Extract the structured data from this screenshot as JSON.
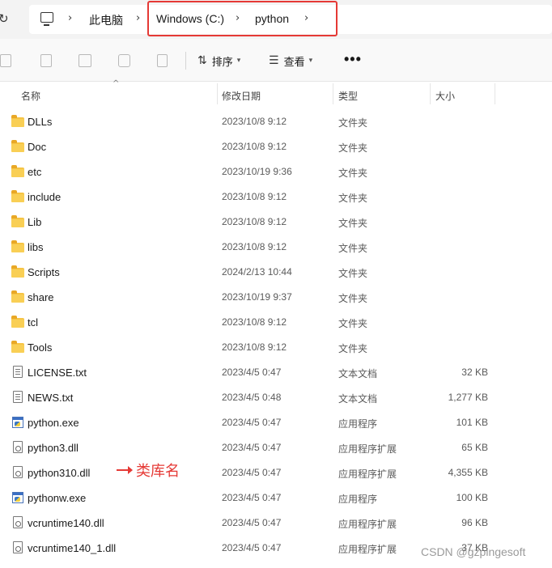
{
  "address": {
    "crumbs": [
      "此电脑",
      "Windows (C:)",
      "python"
    ],
    "highlight_color": "#e53935"
  },
  "toolbar": {
    "sort_label": "排序",
    "view_label": "查看",
    "more_label": "•••",
    "icons": [
      "copy-icon",
      "paste-icon",
      "rename-icon",
      "share-icon",
      "delete-icon"
    ]
  },
  "columns": {
    "name": "名称",
    "date": "修改日期",
    "type": "类型",
    "size": "大小"
  },
  "files": [
    {
      "name": "DLLs",
      "date": "2023/10/8 9:12",
      "type": "文件夹",
      "size": "",
      "icon": "folder"
    },
    {
      "name": "Doc",
      "date": "2023/10/8 9:12",
      "type": "文件夹",
      "size": "",
      "icon": "folder"
    },
    {
      "name": "etc",
      "date": "2023/10/19 9:36",
      "type": "文件夹",
      "size": "",
      "icon": "folder"
    },
    {
      "name": "include",
      "date": "2023/10/8 9:12",
      "type": "文件夹",
      "size": "",
      "icon": "folder"
    },
    {
      "name": "Lib",
      "date": "2023/10/8 9:12",
      "type": "文件夹",
      "size": "",
      "icon": "folder"
    },
    {
      "name": "libs",
      "date": "2023/10/8 9:12",
      "type": "文件夹",
      "size": "",
      "icon": "folder"
    },
    {
      "name": "Scripts",
      "date": "2024/2/13 10:44",
      "type": "文件夹",
      "size": "",
      "icon": "folder"
    },
    {
      "name": "share",
      "date": "2023/10/19 9:37",
      "type": "文件夹",
      "size": "",
      "icon": "folder"
    },
    {
      "name": "tcl",
      "date": "2023/10/8 9:12",
      "type": "文件夹",
      "size": "",
      "icon": "folder"
    },
    {
      "name": "Tools",
      "date": "2023/10/8 9:12",
      "type": "文件夹",
      "size": "",
      "icon": "folder"
    },
    {
      "name": "LICENSE.txt",
      "date": "2023/4/5 0:47",
      "type": "文本文档",
      "size": "32 KB",
      "icon": "txt"
    },
    {
      "name": "NEWS.txt",
      "date": "2023/4/5 0:48",
      "type": "文本文档",
      "size": "1,277 KB",
      "icon": "txt"
    },
    {
      "name": "python.exe",
      "date": "2023/4/5 0:47",
      "type": "应用程序",
      "size": "101 KB",
      "icon": "exe"
    },
    {
      "name": "python3.dll",
      "date": "2023/4/5 0:47",
      "type": "应用程序扩展",
      "size": "65 KB",
      "icon": "dll"
    },
    {
      "name": "python310.dll",
      "date": "2023/4/5 0:47",
      "type": "应用程序扩展",
      "size": "4,355 KB",
      "icon": "dll"
    },
    {
      "name": "pythonw.exe",
      "date": "2023/4/5 0:47",
      "type": "应用程序",
      "size": "100 KB",
      "icon": "exe"
    },
    {
      "name": "vcruntime140.dll",
      "date": "2023/4/5 0:47",
      "type": "应用程序扩展",
      "size": "96 KB",
      "icon": "dll"
    },
    {
      "name": "vcruntime140_1.dll",
      "date": "2023/4/5 0:47",
      "type": "应用程序扩展",
      "size": "37 KB",
      "icon": "dll"
    }
  ],
  "annotation": {
    "text": "类库名",
    "color": "#e53935"
  },
  "watermark": "CSDN @gzpingesoft"
}
